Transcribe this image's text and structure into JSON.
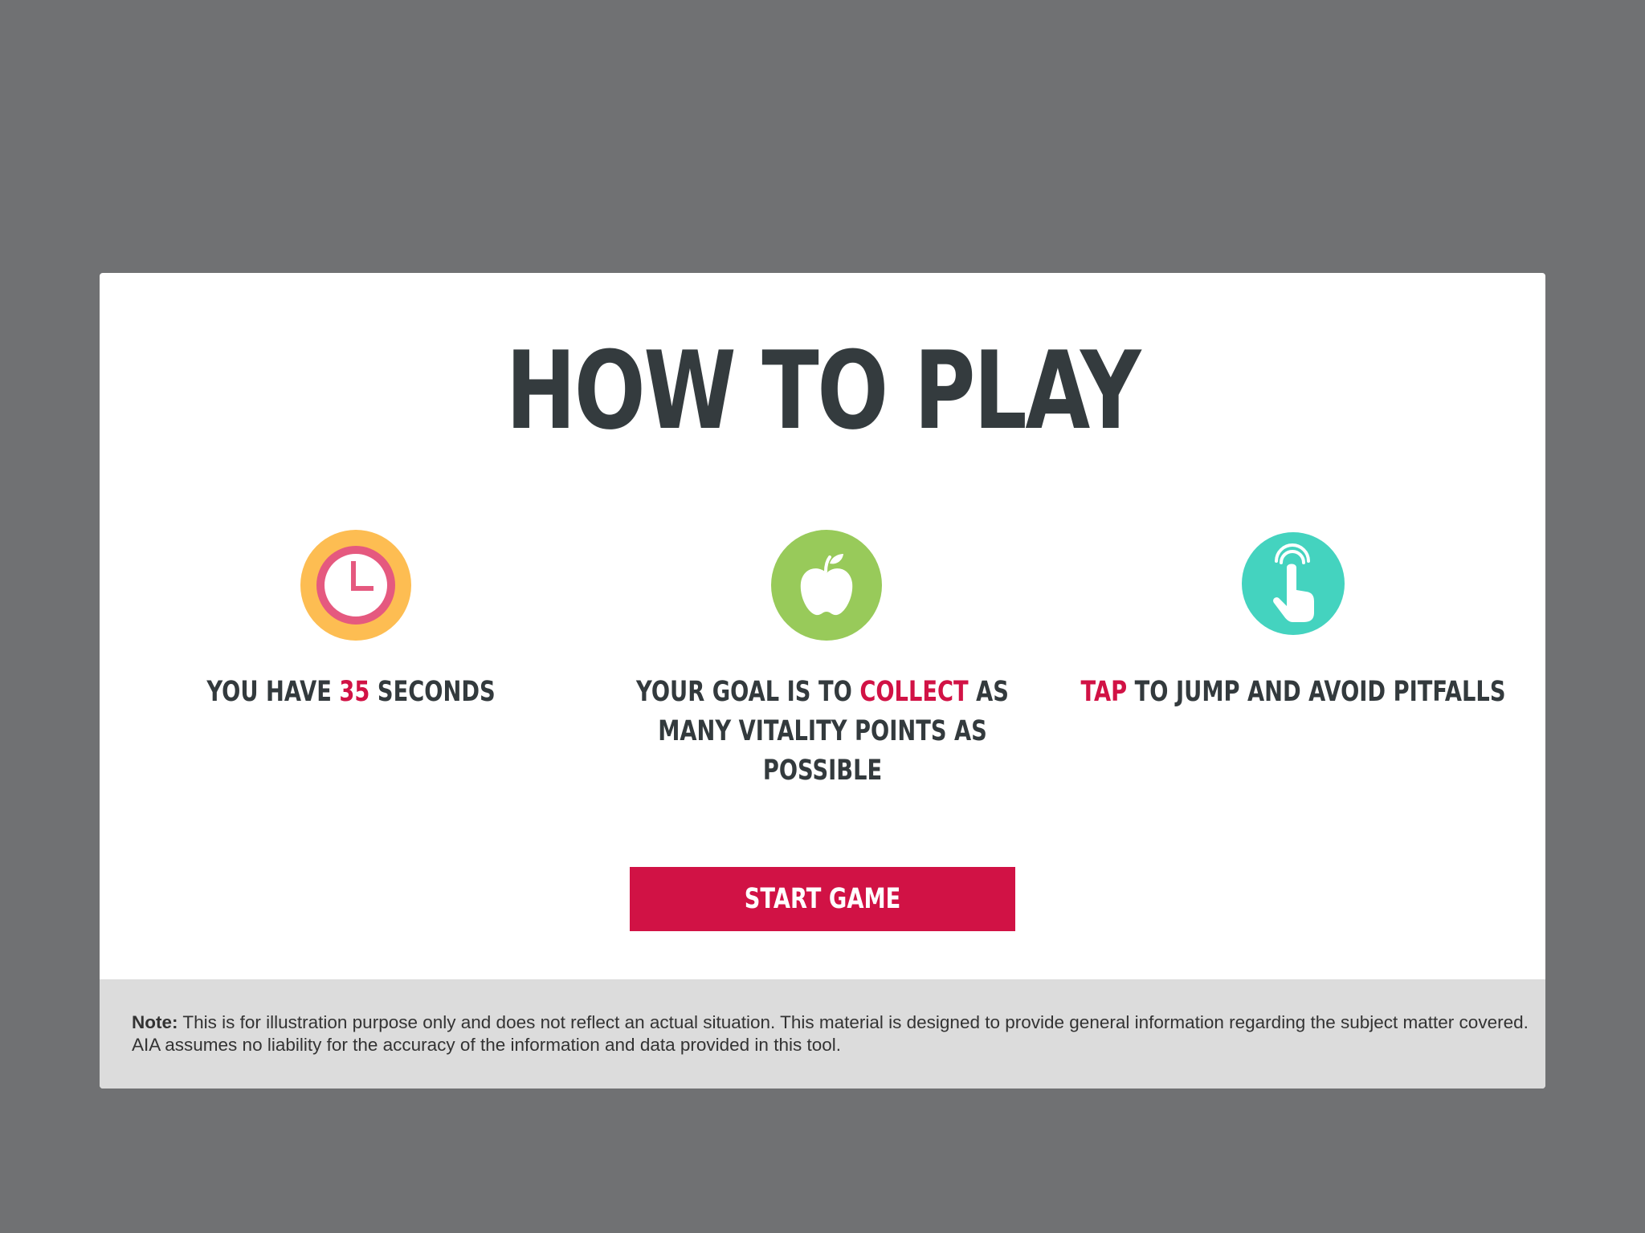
{
  "colors": {
    "backdrop": "#707173",
    "panel": "#ffffff",
    "text_dark": "#343b3e",
    "accent": "#d11245",
    "note_bg": "#dcdcdc",
    "clock_circle": "#fdbd52",
    "clock_face": "#e5597f",
    "apple_circle": "#98ca5a",
    "tap_circle": "#44d3bf"
  },
  "modal": {
    "title": "HOW TO PLAY",
    "steps": [
      {
        "icon": "clock-icon",
        "text_before": "YOU HAVE",
        "highlight": "35",
        "text_after": "SECONDS"
      },
      {
        "icon": "apple-icon",
        "text_before": "YOUR GOAL IS TO",
        "highlight": "COLLECT",
        "text_after": "AS MANY VITALITY POINTS AS POSSIBLE"
      },
      {
        "icon": "tap-hand-icon",
        "text_before": "",
        "highlight": "TAP",
        "text_after": "TO JUMP AND AVOID PITFALLS"
      }
    ],
    "start_button": "START GAME"
  },
  "note": {
    "label": "Note:",
    "text": "This is for illustration purpose only and does not reflect an actual situation. This material is designed to provide general information regarding the subject matter covered. AIA assumes no liability for the accuracy of the information and data provided in this tool."
  }
}
